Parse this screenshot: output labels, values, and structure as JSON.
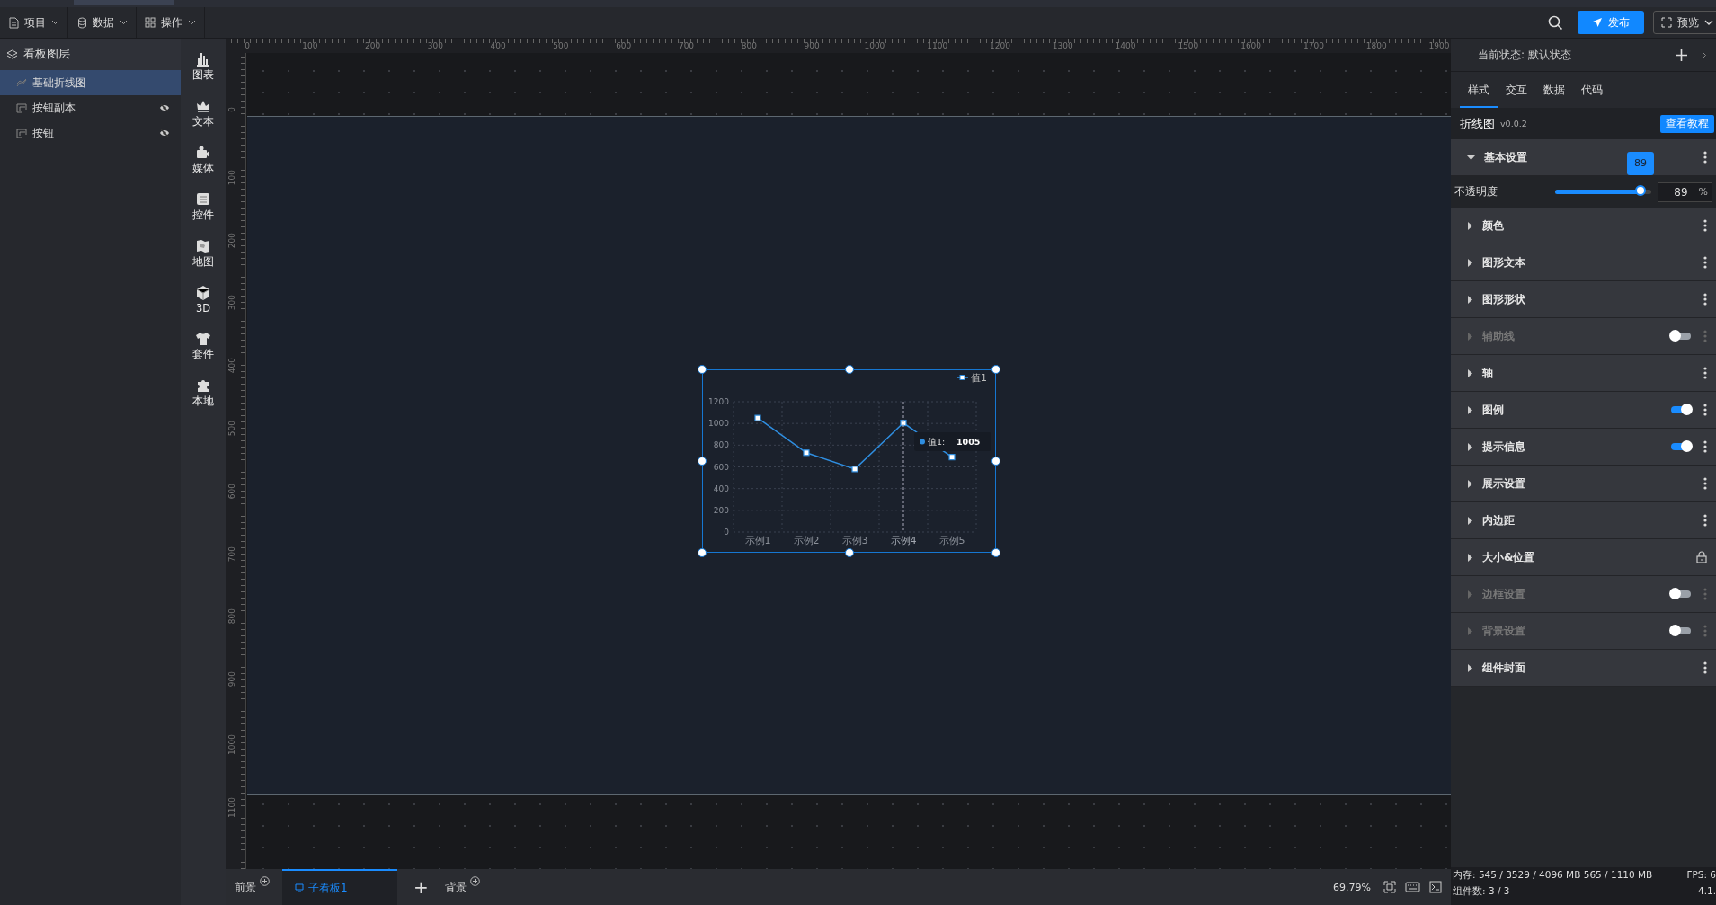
{
  "topbar": {
    "menus": [
      {
        "label": "项目"
      },
      {
        "label": "数据"
      },
      {
        "label": "操作"
      }
    ],
    "publish": "发布",
    "preview": "预览"
  },
  "layers": {
    "title": "看板图层",
    "items": [
      {
        "label": "基础折线图",
        "selected": true,
        "hidden": false,
        "kind": "chart"
      },
      {
        "label": "按钮副本",
        "selected": false,
        "hidden": true,
        "kind": "button"
      },
      {
        "label": "按钮",
        "selected": false,
        "hidden": true,
        "kind": "button"
      }
    ]
  },
  "tools": [
    {
      "label": "图表"
    },
    {
      "label": "文本"
    },
    {
      "label": "媒体"
    },
    {
      "label": "控件"
    },
    {
      "label": "地图"
    },
    {
      "label": "3D"
    },
    {
      "label": "套件"
    },
    {
      "label": "本地"
    }
  ],
  "ruler": {
    "x_labels": [
      "0",
      "100",
      "200",
      "300",
      "400",
      "500",
      "600",
      "700",
      "800",
      "900",
      "1000",
      "1100",
      "1200",
      "1300",
      "1400",
      "1500",
      "1600",
      "1700",
      "1800",
      "1900"
    ],
    "y_labels": [
      "0",
      "100",
      "200",
      "300",
      "400",
      "500",
      "600",
      "700",
      "800",
      "900",
      "1000",
      "1100"
    ]
  },
  "chart": {
    "tooltip": {
      "label": "值1:",
      "value": "1005"
    },
    "hover": [
      false,
      false,
      false,
      true,
      false
    ],
    "chart_data": {
      "type": "line",
      "categories": [
        "示例1",
        "示例2",
        "示例3",
        "示例4",
        "示例5"
      ],
      "series": [
        {
          "name": "值1",
          "color": "#2f8ee0",
          "marker": "square",
          "values": [
            1050,
            730,
            580,
            1005,
            690
          ]
        }
      ],
      "ylim": [
        0,
        1200
      ],
      "yticks": [
        0,
        200,
        400,
        600,
        800,
        1000,
        1200
      ],
      "grid": true
    }
  },
  "bottombar": {
    "foreground": "前景",
    "tabs": [
      {
        "label": "子看板1",
        "selected": true
      }
    ],
    "add": "+",
    "background": "背景",
    "zoom": "69.79%"
  },
  "status": {
    "memory": "内存:  545 / 3529 / 4096 MB  565 / 1110 MB",
    "fps": "FPS: 6",
    "components": "组件数: 3 / 3",
    "version": "4.1."
  },
  "panel": {
    "state_label": "当前状态:",
    "state_value": "默认状态",
    "tabs": [
      {
        "label": "样式",
        "selected": true
      },
      {
        "label": "交互",
        "selected": false
      },
      {
        "label": "数据",
        "selected": false
      },
      {
        "label": "代码",
        "selected": false
      }
    ],
    "component": "折线图",
    "version": "v0.0.2",
    "tutorial": "查看教程",
    "basic": {
      "label": "基本设置",
      "expanded": true
    },
    "opacity": {
      "label": "不透明度",
      "level": 0.89,
      "bubble": "89",
      "value": "89",
      "unit": "%"
    },
    "sections": [
      {
        "label": "颜色",
        "kind": "menu",
        "disabled": false
      },
      {
        "label": "图形文本",
        "kind": "menu",
        "disabled": false
      },
      {
        "label": "图形形状",
        "kind": "menu",
        "disabled": false
      },
      {
        "label": "辅助线",
        "kind": "toggle",
        "on": false,
        "disabled": true
      },
      {
        "label": "轴",
        "kind": "menu",
        "disabled": false
      },
      {
        "label": "图例",
        "kind": "toggle",
        "on": true,
        "disabled": false
      },
      {
        "label": "提示信息",
        "kind": "toggle",
        "on": true,
        "disabled": false
      },
      {
        "label": "展示设置",
        "kind": "menu",
        "disabled": false
      },
      {
        "label": "内边距",
        "kind": "menu",
        "disabled": false
      },
      {
        "label": "大小&位置",
        "kind": "lock",
        "disabled": false
      },
      {
        "label": "边框设置",
        "kind": "toggle",
        "on": false,
        "disabled": true
      },
      {
        "label": "背景设置",
        "kind": "toggle",
        "on": false,
        "disabled": true
      },
      {
        "label": "组件封面",
        "kind": "menu",
        "disabled": false
      }
    ]
  }
}
